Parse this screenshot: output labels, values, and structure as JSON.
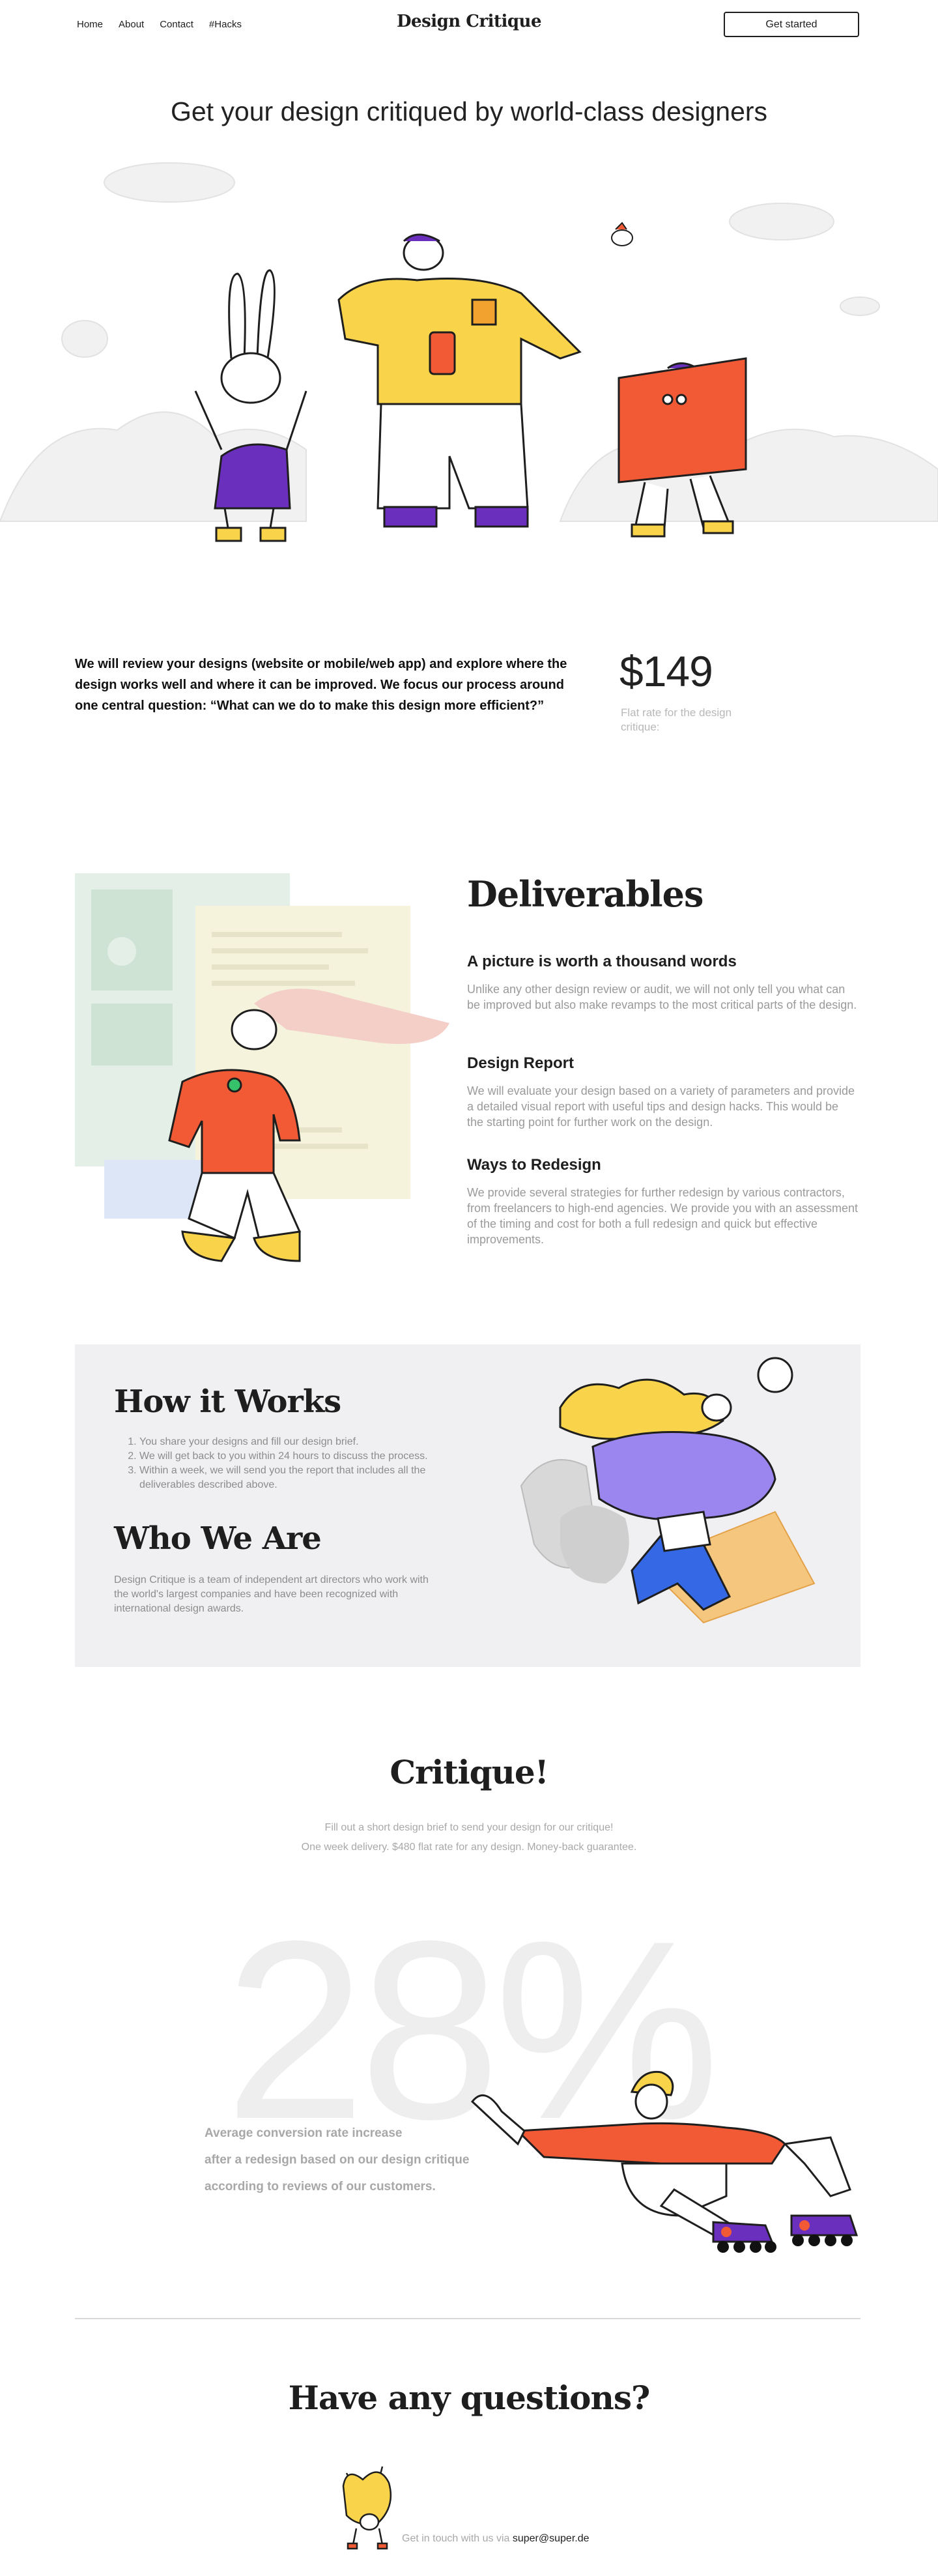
{
  "nav": {
    "links": [
      "Home",
      "About",
      "Contact",
      "#Hacks"
    ],
    "brand": "Design Critique",
    "cta": "Get started"
  },
  "hero": {
    "title": "Get your design critiqued by world-class designers"
  },
  "pricing": {
    "pitch": "We will review your designs (website or mobile/web app) and explore where the design works well and where it can be improved. We focus our process around one central question: “What can we do to make this design more efficient?”",
    "price": "$149",
    "note": "Flat rate for the design critique:"
  },
  "deliverables": {
    "title": "Deliverables",
    "items": [
      {
        "title": "A picture is worth a thousand words",
        "text": "Unlike any other design review or audit, we will not only tell you what can be improved but also make revamps to the most critical parts of the design."
      },
      {
        "title": "Design Report",
        "text": "We will evaluate your design based on a variety of parameters and provide a detailed visual report with useful tips and design hacks. This would be the starting point for further work on the design."
      },
      {
        "title": "Ways to Redesign",
        "text": "We provide several strategies for further redesign by various contractors, from freelancers to high-end agencies. We provide you with an assessment of the timing and cost for both a full redesign and quick but effective improvements."
      }
    ]
  },
  "how": {
    "title": "How it Works",
    "steps": [
      "You share your designs and fill our design brief.",
      "We will get back to you within 24 hours to discuss the process.",
      "Within a week, we will send you the report that includes all the deliverables described above."
    ],
    "who_title": "Who We Are",
    "who_text": "Design Critique is a team of independent art directors who work with the world's largest companies and have been recognized with international design awards."
  },
  "critique": {
    "title": "Critique!",
    "line1": "Fill out a short design brief to send your design for our critique!",
    "line2": "One week delivery. $480 flat rate for any design. Money-back guarantee."
  },
  "stats": {
    "number": "28%",
    "lines": [
      "Average conversion rate increase",
      "after a redesign based on our design critique",
      "according to reviews of our customers."
    ]
  },
  "questions": {
    "title": "Have any questions?",
    "contact_prefix": "Get in touch with us via ",
    "email": "super@super.de"
  },
  "colors": {
    "yellow": "#f9d44a",
    "purple": "#6b2fbd",
    "orange": "#f25a36",
    "lavender": "#9b86ef",
    "blue": "#3568e5",
    "gray_bg": "#f0f0f2"
  }
}
